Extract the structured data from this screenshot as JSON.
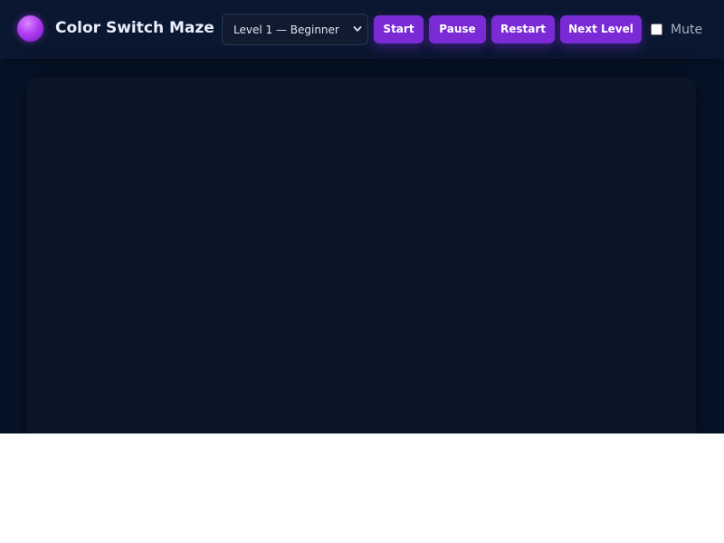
{
  "header": {
    "title": "Color Switch Maze",
    "logo_icon": "purple-ball-icon"
  },
  "controls": {
    "level_select": {
      "selected": "Level 1 — Beginner"
    },
    "buttons": {
      "start": "Start",
      "pause": "Pause",
      "restart": "Restart",
      "next_level": "Next Level"
    },
    "mute": {
      "label": "Mute",
      "checked": false
    }
  },
  "colors": {
    "background": "#06142b",
    "topbar": "#0a1730",
    "accent": "#7a2bd6",
    "canvas": "#0a1628"
  }
}
